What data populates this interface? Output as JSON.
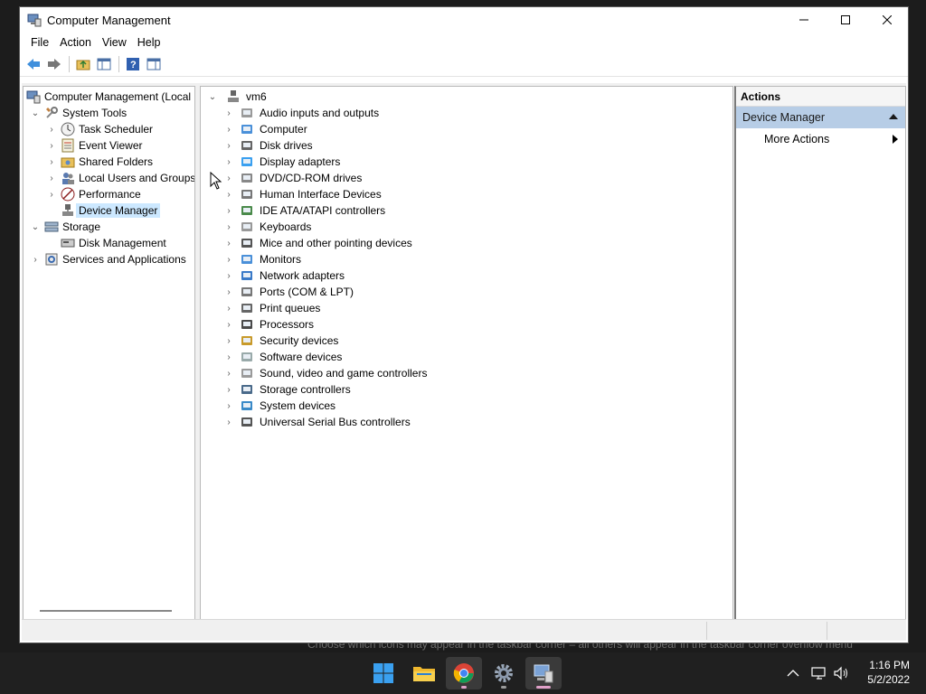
{
  "window": {
    "title": "Computer Management"
  },
  "menu": [
    "File",
    "Action",
    "View",
    "Help"
  ],
  "tree": {
    "root": "Computer Management (Local",
    "items": [
      {
        "label": "System Tools",
        "level": 1,
        "expanded": true
      },
      {
        "label": "Task Scheduler",
        "level": 2
      },
      {
        "label": "Event Viewer",
        "level": 2
      },
      {
        "label": "Shared Folders",
        "level": 2
      },
      {
        "label": "Local Users and Groups",
        "level": 2
      },
      {
        "label": "Performance",
        "level": 2
      },
      {
        "label": "Device Manager",
        "level": 2,
        "selected": true
      },
      {
        "label": "Storage",
        "level": 1,
        "expanded": true
      },
      {
        "label": "Disk Management",
        "level": 2
      },
      {
        "label": "Services and Applications",
        "level": 1
      }
    ]
  },
  "devices": {
    "computer_name": "vm6",
    "categories": [
      "Audio inputs and outputs",
      "Computer",
      "Disk drives",
      "Display adapters",
      "DVD/CD-ROM drives",
      "Human Interface Devices",
      "IDE ATA/ATAPI controllers",
      "Keyboards",
      "Mice and other pointing devices",
      "Monitors",
      "Network adapters",
      "Ports (COM & LPT)",
      "Print queues",
      "Processors",
      "Security devices",
      "Software devices",
      "Sound, video and game controllers",
      "Storage controllers",
      "System devices",
      "Universal Serial Bus controllers"
    ]
  },
  "actions": {
    "header": "Actions",
    "group": "Device Manager",
    "more": "More Actions"
  },
  "tooltip": "Choose which icons may appear in the taskbar corner – all others will appear in the taskbar corner overflow menu",
  "clock": {
    "time": "1:16 PM",
    "date": "5/2/2022"
  },
  "colors": {
    "selection": "#cce8ff",
    "actions_group": "#b7cde6",
    "taskbar": "#202020"
  }
}
